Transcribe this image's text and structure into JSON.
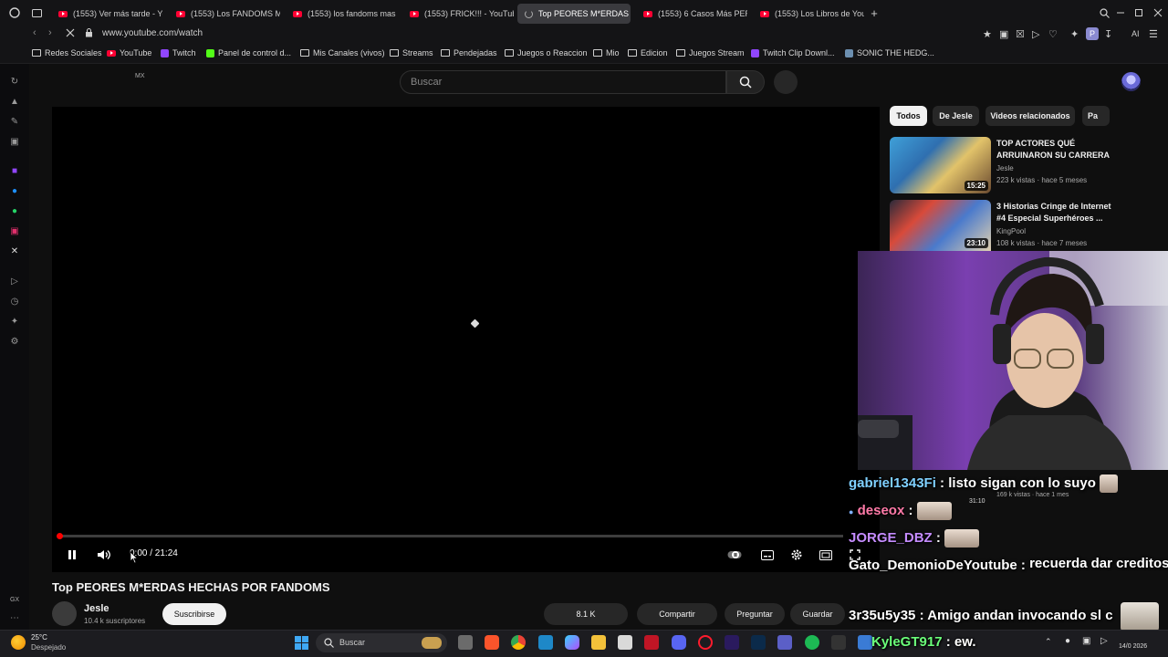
{
  "browser": {
    "tabs": [
      {
        "label": "(1553) Ver más tarde - You",
        "active": false
      },
      {
        "label": "(1553) Los FANDOMS MÁ",
        "active": false
      },
      {
        "label": "(1553) los fandoms mas tu",
        "active": false
      },
      {
        "label": "(1553) FRICK!!! - YouTube",
        "active": false
      },
      {
        "label": "Top PEORES M*ERDAS H",
        "active": true
      },
      {
        "label": "(1553) 6 Casos Más PERT",
        "active": false
      },
      {
        "label": "(1553) Los Libros de YouT",
        "active": false
      }
    ],
    "new_tab": "+",
    "url": "www.youtube.com/watch",
    "ai_label": "AI",
    "profile_letter": "P",
    "bookmarks": [
      "Redes Sociales",
      "YouTube",
      "Twitch",
      "Panel de control d...",
      "Mis Canales (vivos)",
      "Streams",
      "Pendejadas",
      "Juegos o Reaccion",
      "Mio",
      "Edicion",
      "Juegos Stream",
      "Twitch Clip Downl...",
      "SONIC THE HEDG..."
    ],
    "sidebar_gx": "GX"
  },
  "youtube": {
    "country": "MX",
    "search_placeholder": "Buscar",
    "player": {
      "time": "0:00 / 21:24",
      "progress": 0.0
    },
    "video_title": "Top PEORES M*ERDAS HECHAS POR FANDOMS",
    "channel": {
      "name": "Jesle",
      "subs": "10.4 k suscriptores",
      "subscribe": "Suscribirse"
    },
    "actions": {
      "likes": "8.1 K",
      "share": "Compartir",
      "ask": "Preguntar",
      "save": "Guardar"
    },
    "chips": [
      "Todos",
      "De Jesle",
      "Videos relacionados",
      "Pa"
    ],
    "related": [
      {
        "title": "TOP ACTORES QUÉ ARRUINARON SU CARRERA",
        "channel": "Jesle",
        "meta": "223 k vistas · hace 5 meses",
        "duration": "15:25"
      },
      {
        "title": "3 Historias Cringe de Internet #4 Especial Superhéroes ...",
        "channel": "KingPool",
        "meta": "108 k vistas · hace 7 meses",
        "duration": "23:10"
      }
    ],
    "partial_meta": "169 k vistas · hace 1 mes",
    "partial_duration": "31:10"
  },
  "chat": [
    {
      "user": "gabriel1343Fi",
      "color": "#7fd0ff",
      "message": "listo sigan con lo suyo"
    },
    {
      "user": "deseox",
      "color": "#ff7aa8",
      "message": ""
    },
    {
      "user": "JORGE_DBZ",
      "color": "#c58cff",
      "message": ""
    },
    {
      "user": "Gato_DemonioDeYoutube",
      "color": "#ffffff",
      "message": "recuerda dar creditos al canal"
    },
    {
      "user": "3r35u5y35",
      "color": "#ffffff",
      "message": "Amigo andan invocando sl c"
    },
    {
      "user": "KyleGT917",
      "color": "#6bff7a",
      "message": "ew."
    }
  ],
  "taskbar": {
    "weather_temp": "25°C",
    "weather_desc": "Despejado",
    "search": "Buscar",
    "date": "14/0 2026"
  },
  "colors": {
    "accent": "#ff0000",
    "background": "#0f0f0f"
  }
}
